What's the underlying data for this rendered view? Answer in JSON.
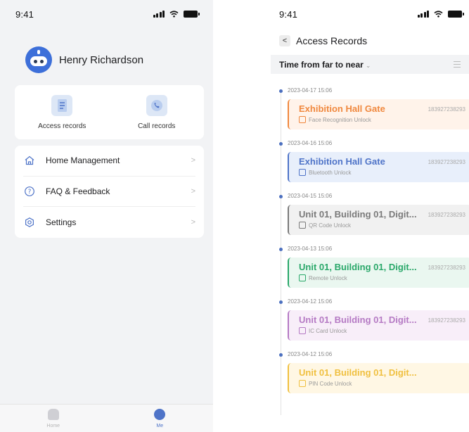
{
  "left": {
    "status_time": "9:41",
    "profile": {
      "name": "Henry Richardson"
    },
    "shortcuts": [
      {
        "label": "Access records",
        "icon": "document-list-icon"
      },
      {
        "label": "Call records",
        "icon": "phone-call-icon"
      }
    ],
    "menu": [
      {
        "label": "Home Management",
        "icon": "home-icon"
      },
      {
        "label": "FAQ & Feedback",
        "icon": "question-icon"
      },
      {
        "label": "Settings",
        "icon": "settings-icon"
      }
    ],
    "tabs": [
      {
        "label": "Home",
        "active": false
      },
      {
        "label": "Me",
        "active": true
      }
    ]
  },
  "right": {
    "status_time": "9:41",
    "title": "Access Records",
    "filter_label": "Time from far to near",
    "records": [
      {
        "time": "2023-04-17 15:06",
        "title": "Exhibition Hall Gate",
        "number": "183927238293",
        "method": "Face Recognition Unlock",
        "accent": "#f0883e",
        "bg": "#fff3ea",
        "icon": "face-recognition-icon"
      },
      {
        "time": "2023-04-16 15:06",
        "title": "Exhibition Hall Gate",
        "number": "183927238293",
        "method": "Bluetooth Unlock",
        "accent": "#4f74c8",
        "bg": "#e8effb",
        "icon": "bluetooth-icon"
      },
      {
        "time": "2023-04-15 15:06",
        "title": "Unit 01, Building 01, Digit...",
        "number": "183927238293",
        "method": "QR Code Unlock",
        "accent": "#7a7a7a",
        "bg": "#f1f1f1",
        "icon": "qr-code-icon"
      },
      {
        "time": "2023-04-13 15:06",
        "title": "Unit 01, Building 01, Digit...",
        "number": "183927238293",
        "method": "Remote Unlock",
        "accent": "#2aa86a",
        "bg": "#eaf7f0",
        "icon": "remote-icon"
      },
      {
        "time": "2023-04-12 15:06",
        "title": "Unit 01, Building 01, Digit...",
        "number": "183927238293",
        "method": "IC Card Unlock",
        "accent": "#b57ac4",
        "bg": "#f8eef9",
        "icon": "ic-card-icon"
      },
      {
        "time": "2023-04-12 15:06",
        "title": "Unit 01, Building 01, Digit...",
        "number": "",
        "method": "PIN Code Unlock",
        "accent": "#f0c040",
        "bg": "#fff7e4",
        "icon": "pin-code-icon"
      }
    ]
  }
}
